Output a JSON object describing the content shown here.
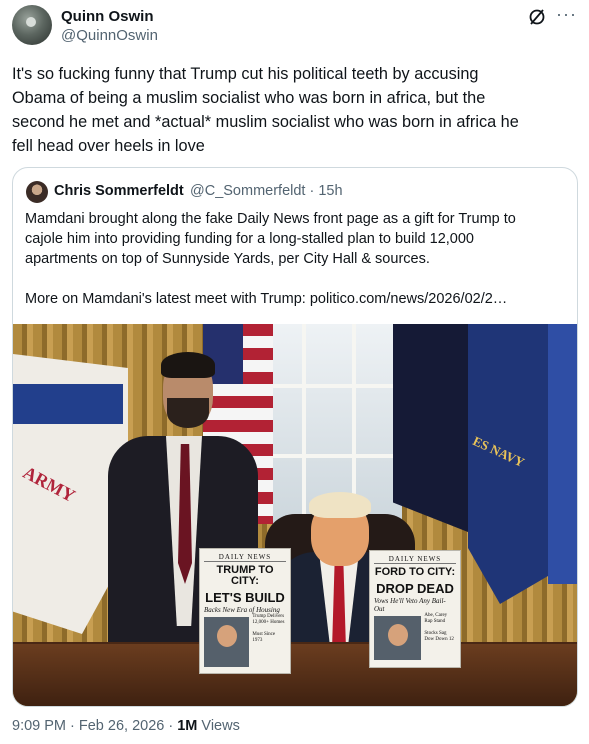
{
  "author": {
    "name": "Quinn Oswin",
    "handle": "@QuinnOswin"
  },
  "tweet": {
    "text_lines": [
      "It's so fucking funny that Trump cut his political teeth by accusing",
      "Obama of being a muslim socialist who was born in africa, but the",
      "second he met and *actual* muslim socialist who was born in africa he",
      "fell head over heels in love"
    ]
  },
  "quote": {
    "name": "Chris Sommerfeldt",
    "handle_time": "@C_Sommerfeldt · 15h",
    "lines": [
      "Mamdani brought along the fake Daily News front page as a gift for Trump to",
      "cajole him into providing funding for a long-stalled plan to build 12,000",
      "apartments on top of Sunnyside Yards, per City Hall & sources.",
      "",
      "More on Mamdani's latest meet with Trump: politico.com/news/2026/02/2…"
    ]
  },
  "photo": {
    "flag_army_text": "ARMY",
    "flag_navy_text": "ES NAVY",
    "paper_left": {
      "masthead": "DAILY NEWS",
      "headline_1": "TRUMP TO CITY:",
      "headline_2": "LET'S BUILD",
      "subhead": "Backs New Era of Housing",
      "small_1": "Trump Delivers 12,000+ Homes",
      "small_2": "Must Since 1973"
    },
    "paper_right": {
      "masthead": "DAILY NEWS",
      "headline_1": "FORD TO CITY:",
      "headline_2": "DROP DEAD",
      "subhead": "Vows He'll Veto Any Bail-Out",
      "small_1": "Abe, Carey Rap Stand",
      "small_2": "Stocks Sag Dow Down 12"
    }
  },
  "meta": {
    "time_date": "9:09 PM · Feb 26, 2026 · ",
    "views_count": "1M",
    "views_label": " Views"
  },
  "icons": {
    "grok": "grok-slash-icon",
    "more": "more-dots-icon"
  }
}
